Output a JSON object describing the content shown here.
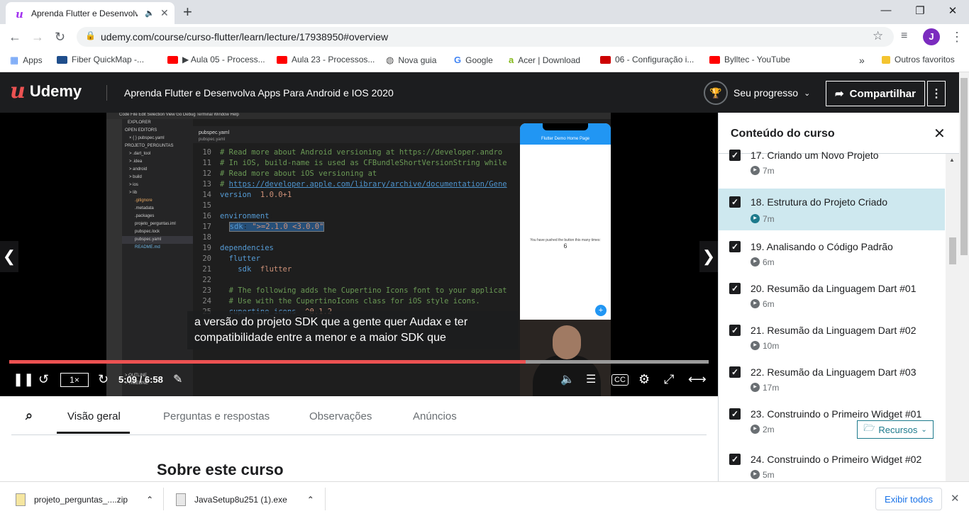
{
  "browser": {
    "tab_title": "Aprenda Flutter e Desenvolv",
    "url": "udemy.com/course/curso-flutter/learn/lecture/17938950#overview",
    "avatar_letter": "J",
    "bookmarks": [
      {
        "label": "Apps",
        "icon": "apps-grid-icon"
      },
      {
        "label": "Fiber QuickMap -...",
        "icon": "map-icon",
        "color": "#1f4e8c"
      },
      {
        "label": "▶ Aula 05 - Process...",
        "icon": "youtube-icon",
        "color": "#ff0000"
      },
      {
        "label": "Aula 23 - Processos...",
        "icon": "youtube-icon",
        "color": "#ff0000"
      },
      {
        "label": "Nova guia",
        "icon": "globe-icon",
        "color": "#555555"
      },
      {
        "label": "Google",
        "icon": "google-icon",
        "color": "#4285f4"
      },
      {
        "label": "Acer | Download",
        "icon": "acer-icon",
        "color": "#83b81a"
      },
      {
        "label": "06 - Configuração i...",
        "icon": "youtube-icon",
        "color": "#cc0000"
      },
      {
        "label": "Bylltec - YouTube",
        "icon": "youtube-icon",
        "color": "#ff0000"
      },
      {
        "label": "»",
        "icon": "more-bookmarks-icon"
      },
      {
        "label": "Outros favoritos",
        "icon": "folder-icon",
        "color": "#f4c430"
      }
    ]
  },
  "header": {
    "logo": "Udemy",
    "course_title": "Aprenda Flutter e Desenvolva Apps Para Android e IOS 2020",
    "progress_label": "Seu progresso",
    "share_label": "Compartilhar"
  },
  "video": {
    "caption_line1": "a versão do projeto SDK que a gente quer Audax e ter",
    "caption_line2": "compatibilidade entre a menor e a maior SDK que",
    "speed": "1×",
    "time": "5:09 / 6:58",
    "progress": 0.738,
    "editor_tab": "pubspec.yaml",
    "breadcrumb": "pubspec.yaml",
    "phone_title": "Flutter Demo Home Page",
    "phone_message": "You have pushed the button this many times:",
    "phone_count": "6",
    "explorer_items": [
      "EXPLORER",
      "OPEN EDITORS",
      "× { } pubspec.yaml",
      "PROJETO_PERGUNTAS",
      "> .dart_tool",
      "> .idea",
      "> android",
      "> build",
      "> ios",
      "> lib",
      ".gitignore",
      ".metadata",
      ".packages",
      "projeto_perguntas.iml",
      "pubspec.lock",
      "pubspec.yaml",
      "README.md"
    ],
    "outline": "> OUTLINE",
    "timeline": "> TIMELINE"
  },
  "lecture_tabs": [
    "Visão geral",
    "Perguntas e respostas",
    "Observações",
    "Anúncios"
  ],
  "about_title": "Sobre este curso",
  "sidebar": {
    "title": "Conteúdo do curso",
    "items": [
      {
        "title": "17. Criando um Novo Projeto",
        "duration": "7m"
      },
      {
        "title": "18. Estrutura do Projeto Criado",
        "duration": "7m"
      },
      {
        "title": "19. Analisando o Código Padrão",
        "duration": "6m"
      },
      {
        "title": "20. Resumão da Linguagem Dart #01",
        "duration": "6m"
      },
      {
        "title": "21. Resumão da Linguagem Dart #02",
        "duration": "10m"
      },
      {
        "title": "22. Resumão da Linguagem Dart #03",
        "duration": "17m"
      },
      {
        "title": "23. Construindo o Primeiro Widget #01",
        "duration": "2m"
      },
      {
        "title": "24. Construindo o Primeiro Widget #02",
        "duration": "5m"
      }
    ],
    "resources_label": "Recursos"
  },
  "downloads": {
    "items": [
      "projeto_perguntas_....zip",
      "JavaSetup8u251 (1).exe"
    ],
    "show_all": "Exibir todos"
  }
}
